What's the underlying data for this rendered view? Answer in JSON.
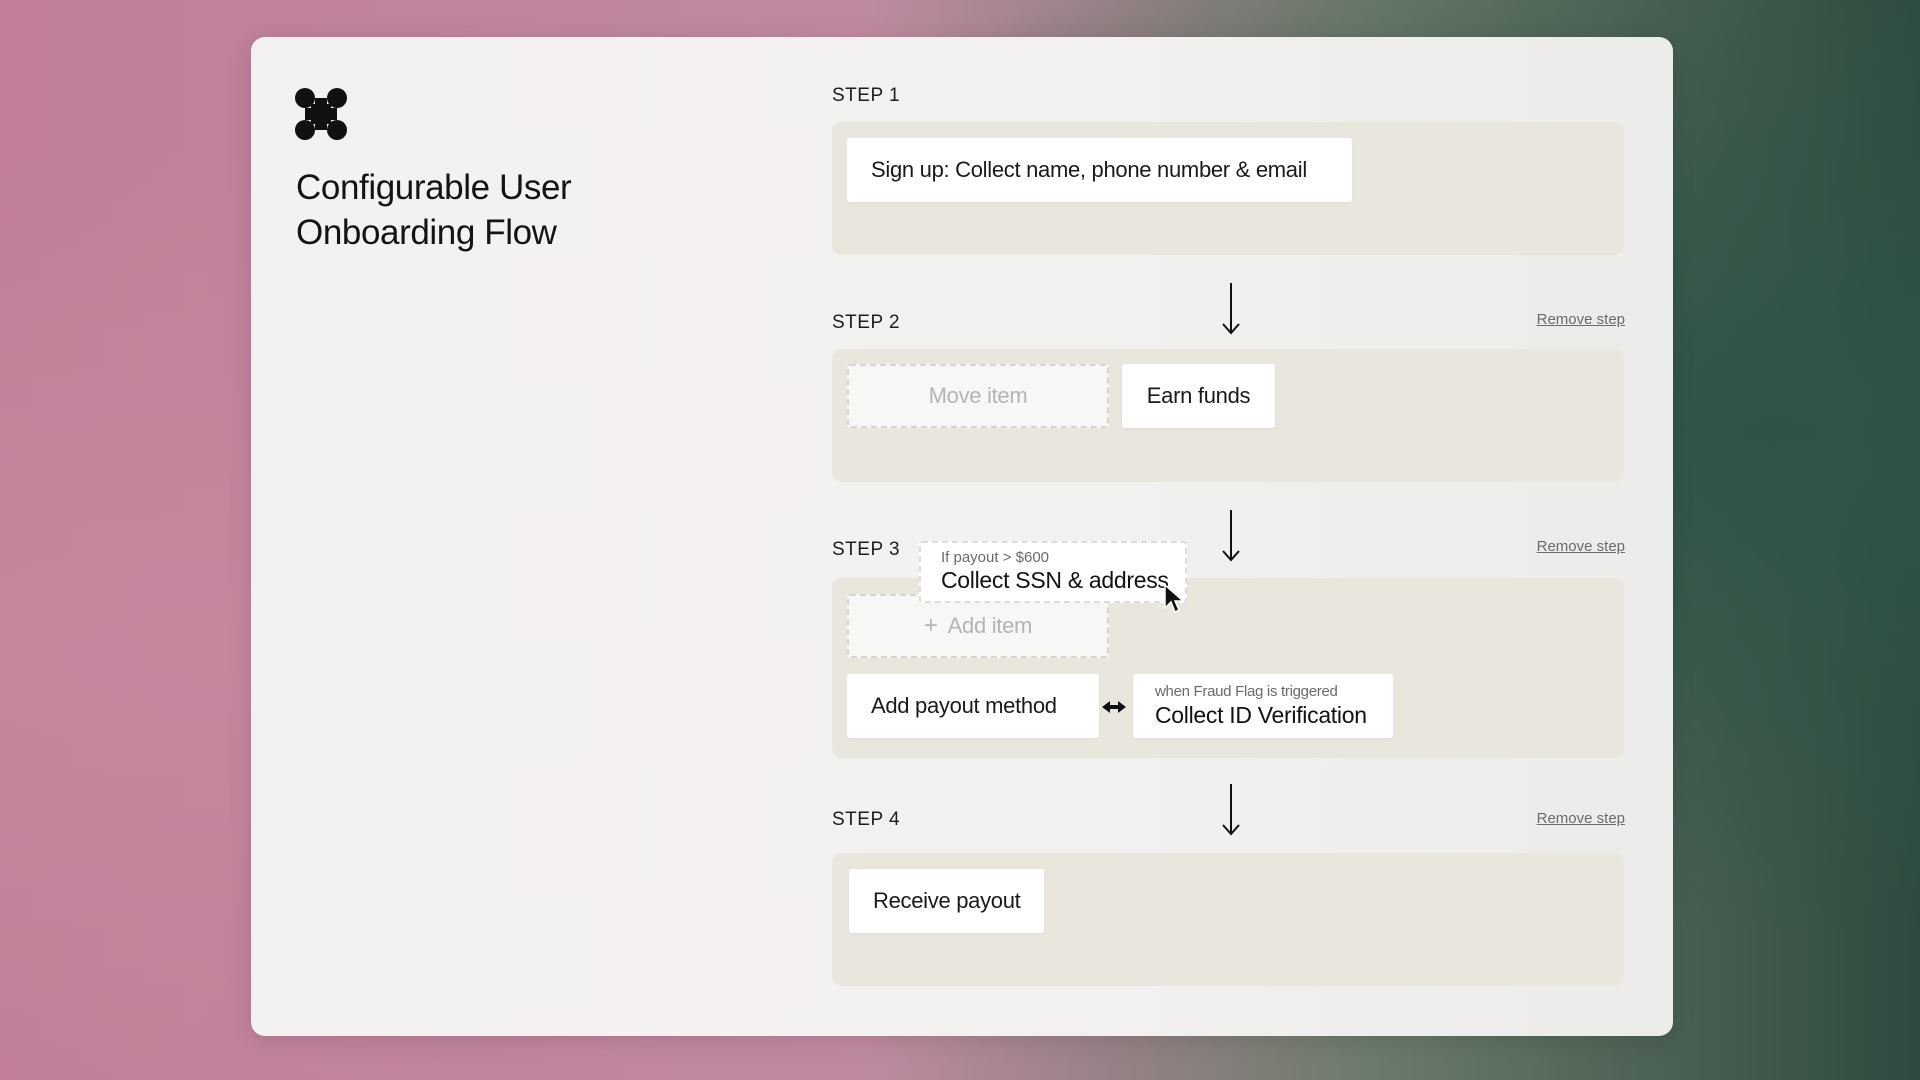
{
  "app": {
    "title": "Configurable User Onboarding Flow"
  },
  "steps": [
    {
      "label": "STEP 1",
      "items": [
        {
          "text": "Sign up: Collect name, phone number & email"
        }
      ]
    },
    {
      "label": "STEP 2",
      "remove_label": "Remove step",
      "placeholder": "Move item",
      "items": [
        {
          "text": "Earn funds"
        }
      ]
    },
    {
      "label": "STEP 3",
      "remove_label": "Remove step",
      "placeholder": "Add item",
      "items": [
        {
          "text": "Add payout method"
        },
        {
          "condition": "when Fraud Flag is triggered",
          "text": "Collect ID Verification"
        }
      ],
      "dragging_item": {
        "condition": "If payout > $600",
        "text": "Collect SSN & address"
      }
    },
    {
      "label": "STEP 4",
      "remove_label": "Remove step",
      "items": [
        {
          "text": "Receive payout"
        }
      ]
    }
  ],
  "icons": {
    "logo": "command-icon",
    "arrow": "arrow-down-icon",
    "link": "link-arrows-icon",
    "cursor": "mouse-pointer-icon",
    "plus": "plus-icon"
  },
  "colors": {
    "panel": "#f3f1f0",
    "step_box": "#e9e7dd",
    "card": "#ffffff",
    "text": "#1a1a1a",
    "muted": "#6b6b6b"
  }
}
